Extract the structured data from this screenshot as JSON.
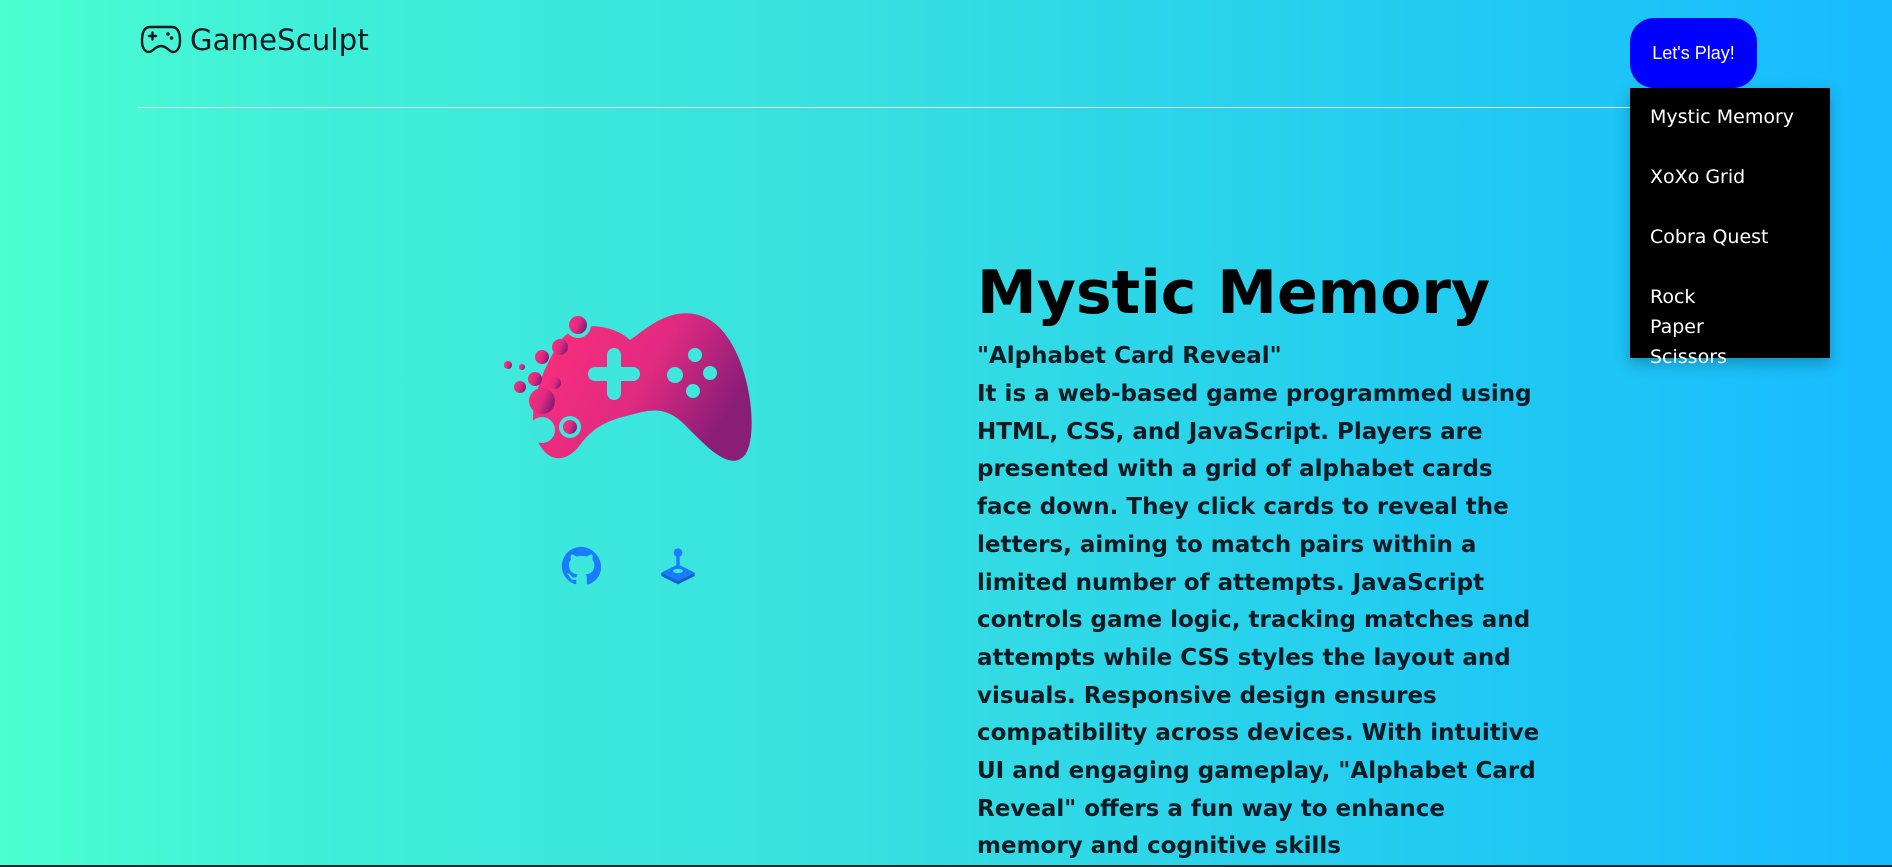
{
  "header": {
    "brand_icon": "gamepad-outline-icon",
    "brand_name": "GameSculpt",
    "play_button": "Let's Play!"
  },
  "dropdown": {
    "items": [
      "Mystic Memory",
      "XoXo Grid",
      "Cobra Quest",
      "Rock Paper Scissors"
    ]
  },
  "hero": {
    "image": "gamepad-illustration",
    "links": [
      {
        "icon": "github-icon"
      },
      {
        "icon": "joystick-icon"
      }
    ]
  },
  "game": {
    "title": "Mystic Memory",
    "subtitle": "\"Alphabet Card Reveal\"",
    "description": "It is a web-based game programmed using HTML, CSS, and JavaScript. Players are presented with a grid of alphabet cards face down. They click cards to reveal the letters, aiming to match pairs within a limited number of attempts. JavaScript controls game logic, tracking matches and attempts while CSS styles the layout and visuals. Responsive design ensures compatibility across devices. With intuitive UI and engaging gameplay, \"Alphabet Card Reveal\" offers a fun way to enhance memory and cognitive skills"
  },
  "colors": {
    "accent_button": "#0000ff",
    "dropdown_bg": "#000000",
    "controller_pink": "#ff2f7a",
    "controller_purple": "#8a1d78",
    "link_icon": "#1a7bff"
  }
}
